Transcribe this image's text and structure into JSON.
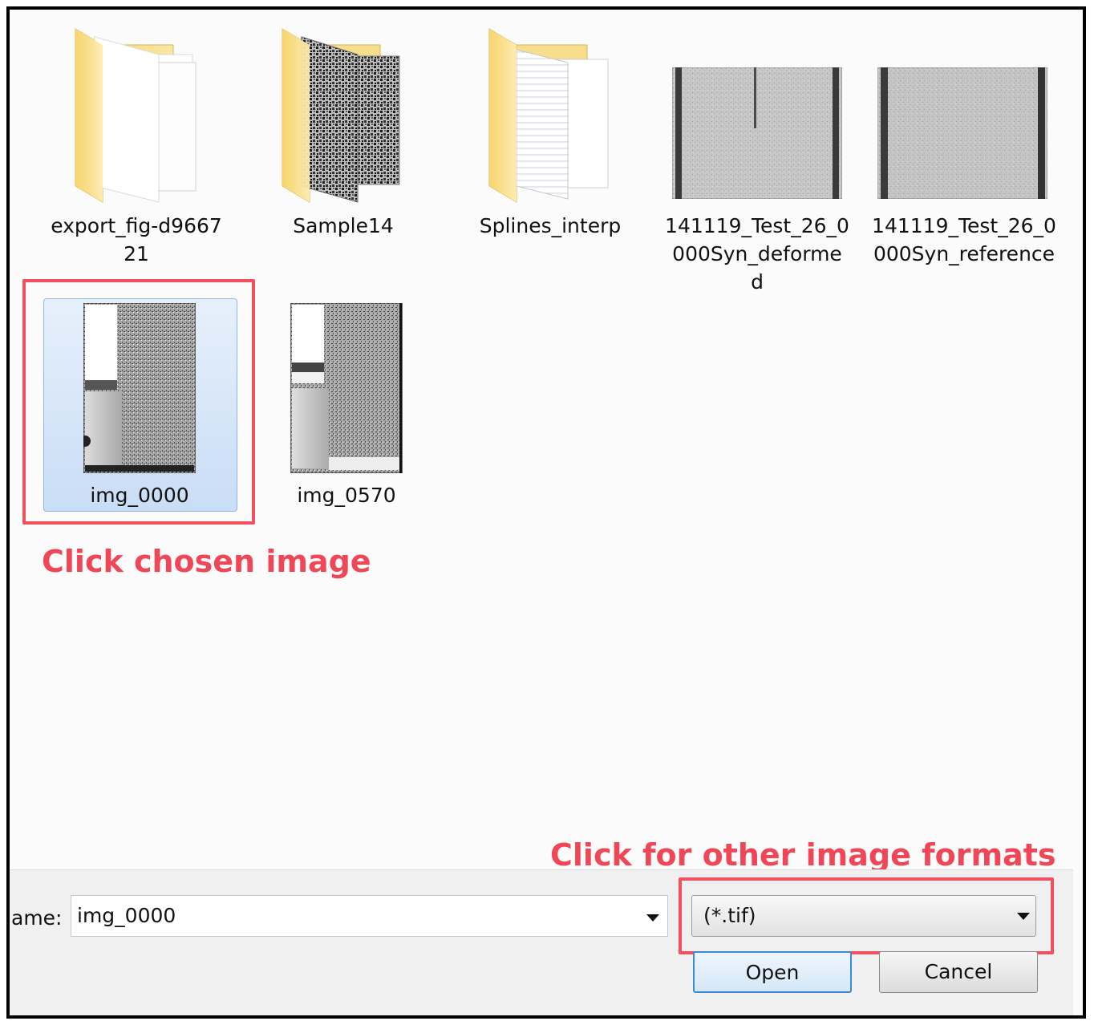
{
  "files": [
    {
      "name": "export_fig-d9667\n21",
      "icon": "folder-docs-icon"
    },
    {
      "name": "Sample14",
      "icon": "folder-speckle-icon"
    },
    {
      "name": "Splines_interp",
      "icon": "folder-pages-icon"
    },
    {
      "name": "141119_Test_26_0\n000Syn_deforme\nd",
      "icon": "image-thumbnail-icon"
    },
    {
      "name": "141119_Test_26_0\n000Syn_reference",
      "icon": "image-thumbnail-icon"
    },
    {
      "name": "img_0000",
      "icon": "image-thumbnail-icon",
      "selected": true
    },
    {
      "name": "img_0570",
      "icon": "image-thumbnail-icon"
    }
  ],
  "annotations": {
    "chosen": "Click chosen image",
    "formats": "Click for other image formats",
    "color": "#f0505f"
  },
  "footer": {
    "filename_label": "ame:",
    "filename_value": "img_0000",
    "filetype_value": "(*.tif)",
    "open_label": "Open",
    "cancel_label": "Cancel"
  },
  "colors": {
    "selection": "#c9ddf6",
    "folder": "#f7d980",
    "accent_button": "#3c8bd0"
  }
}
